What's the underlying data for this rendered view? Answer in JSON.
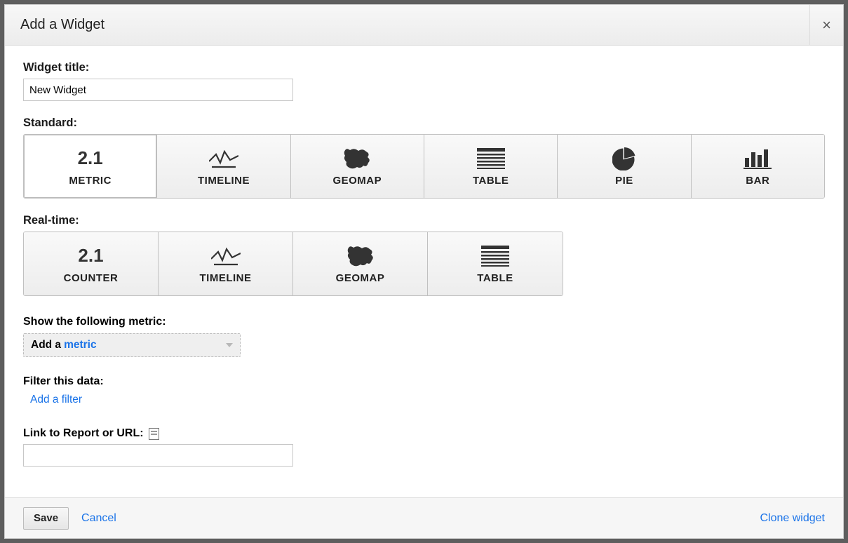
{
  "modal": {
    "title": "Add a Widget",
    "close_label": "×"
  },
  "form": {
    "title_label": "Widget title:",
    "title_value": "New Widget",
    "standard_label": "Standard:",
    "realtime_label": "Real-time:",
    "metric_section_label": "Show the following metric:",
    "add_metric_prefix": "Add a",
    "add_metric_link": "metric",
    "filter_label": "Filter this data:",
    "add_filter_label": "Add a filter",
    "link_label": "Link to Report or URL:",
    "link_value": ""
  },
  "standard_types": [
    {
      "id": "metric",
      "label": "METRIC",
      "number": "2.1",
      "selected": true
    },
    {
      "id": "timeline",
      "label": "TIMELINE"
    },
    {
      "id": "geomap",
      "label": "GEOMAP"
    },
    {
      "id": "table",
      "label": "TABLE"
    },
    {
      "id": "pie",
      "label": "PIE"
    },
    {
      "id": "bar",
      "label": "BAR"
    }
  ],
  "realtime_types": [
    {
      "id": "counter",
      "label": "COUNTER",
      "number": "2.1"
    },
    {
      "id": "timeline",
      "label": "TIMELINE"
    },
    {
      "id": "geomap",
      "label": "GEOMAP"
    },
    {
      "id": "table",
      "label": "TABLE"
    }
  ],
  "footer": {
    "save_label": "Save",
    "cancel_label": "Cancel",
    "clone_label": "Clone widget"
  }
}
